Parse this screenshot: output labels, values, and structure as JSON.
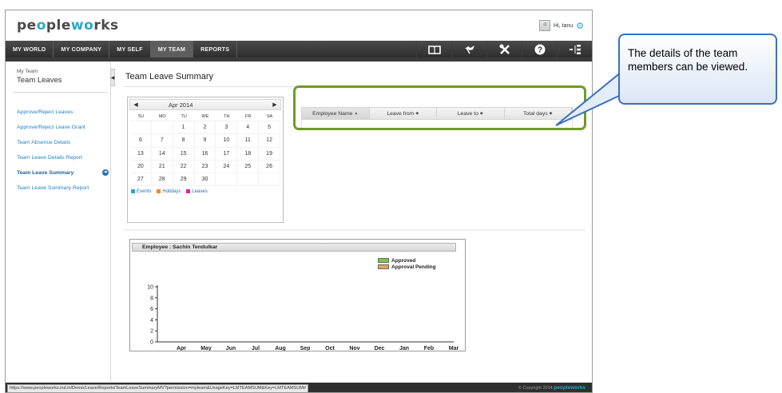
{
  "header": {
    "logo_part1": "pe",
    "logo_part2": "o",
    "logo_part3": "ple",
    "logo_part4": "w",
    "logo_part5": "o",
    "logo_part6": "rks",
    "greeting": "Hi, tanu"
  },
  "nav": {
    "tabs": [
      "MY WORLD",
      "MY COMPANY",
      "MY SELF",
      "MY TEAM",
      "REPORTS"
    ],
    "active": "MY TEAM"
  },
  "sidebar": {
    "breadcrumb": "My Team",
    "title": "Team Leaves",
    "items": [
      "Approve/Reject Leaves",
      "Approve/Reject Leave Grant",
      "Team Absence Details",
      "Team Leave Details Report",
      "Team Leave Summary",
      "Team Leave Summary Report"
    ],
    "active_index": 4
  },
  "main": {
    "title": "Team Leave Summary"
  },
  "calendar": {
    "month": "Apr 2014",
    "prev": "◀",
    "next": "▶",
    "weekdays": [
      "SU",
      "MO",
      "TU",
      "WE",
      "TH",
      "FR",
      "SA"
    ],
    "days": [
      "",
      "",
      "1",
      "2",
      "3",
      "4",
      "5",
      "6",
      "7",
      "8",
      "9",
      "10",
      "11",
      "12",
      "13",
      "14",
      "15",
      "16",
      "17",
      "18",
      "19",
      "20",
      "21",
      "22",
      "23",
      "24",
      "25",
      "26",
      "27",
      "28",
      "29",
      "30",
      "",
      "",
      ""
    ],
    "legend": [
      {
        "label": "Events",
        "color": "#2aa0e0"
      },
      {
        "label": "Holidays",
        "color": "#f28a1e"
      },
      {
        "label": "Leaves",
        "color": "#e21bb1"
      }
    ]
  },
  "table": {
    "columns": [
      "Employee Name",
      "Leave from",
      "Leave to",
      "Total days"
    ],
    "sorted_column": 0,
    "sort_asc": "▲",
    "sort_both": "◆"
  },
  "chart_data": {
    "type": "bar",
    "title": "Employee : Sachin Tendulkar",
    "categories": [
      "Apr",
      "May",
      "Jun",
      "Jul",
      "Aug",
      "Sep",
      "Oct",
      "Nov",
      "Dec",
      "Jan",
      "Feb",
      "Mar"
    ],
    "series": [
      {
        "name": "Approved",
        "color": "#7cc34a",
        "values": [
          0,
          0,
          0,
          0,
          0,
          0,
          0,
          0,
          0,
          0,
          0,
          0
        ]
      },
      {
        "name": "Approval Pending",
        "color": "#e8a25c",
        "values": [
          0,
          0,
          0,
          0,
          0,
          0,
          0,
          0,
          0,
          0,
          0,
          0
        ]
      }
    ],
    "yticks": [
      0,
      2,
      4,
      6,
      8,
      10
    ],
    "ylim": [
      0,
      10
    ],
    "grid": false,
    "legend_position": "top-right"
  },
  "status": {
    "url": "https://www.peopleworks.ind.in/Demo/Leave/Reports/TeamLeaveSummaryMV?permission=myteam&UsageKey=LMTEAMSUM&Key=LMTEAMSUM#",
    "copyright": "© Copyright 2014",
    "brand": "peopleworks"
  },
  "callout": {
    "text": "The details of the team members can be viewed."
  }
}
